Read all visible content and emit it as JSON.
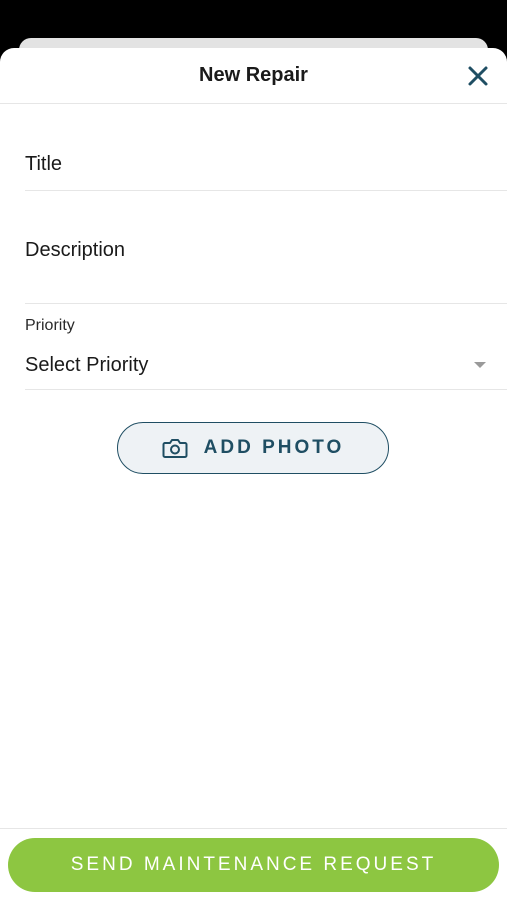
{
  "header": {
    "title": "New Repair",
    "close_icon": "close-icon"
  },
  "form": {
    "title_placeholder": "Title",
    "description_placeholder": "Description",
    "priority_label": "Priority",
    "priority_value": "Select Priority",
    "priority_icon": "chevron-down-icon"
  },
  "photo_button": {
    "label": "ADD PHOTO",
    "icon": "camera-icon"
  },
  "footer": {
    "send_label": "SEND MAINTENANCE REQUEST"
  },
  "colors": {
    "accent_dark": "#1f4e63",
    "accent_green": "#8dc641",
    "background": "#ffffff",
    "divider": "#e6e6e6"
  }
}
